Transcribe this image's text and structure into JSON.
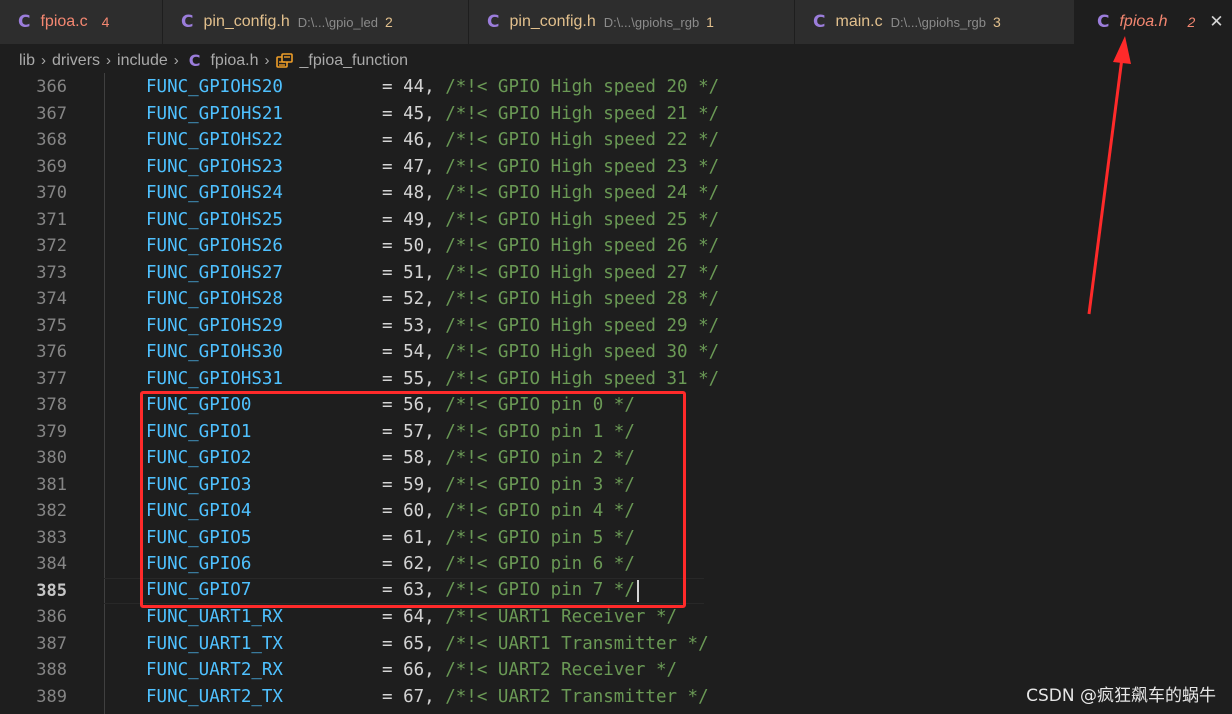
{
  "tabs": [
    {
      "lang": "C",
      "name": "fpioa.c",
      "path": "",
      "count": "4"
    },
    {
      "lang": "C",
      "name": "pin_config.h",
      "path": "D:\\...\\gpio_led",
      "count": "2"
    },
    {
      "lang": "C",
      "name": "pin_config.h",
      "path": "D:\\...\\gpiohs_rgb",
      "count": "1"
    },
    {
      "lang": "C",
      "name": "main.c",
      "path": "D:\\...\\gpiohs_rgb",
      "count": "3"
    },
    {
      "lang": "C",
      "name": "fpioa.h",
      "path": "",
      "count": "2",
      "close": "✕"
    }
  ],
  "breadcrumb": {
    "items": [
      "lib",
      "drivers",
      "include"
    ],
    "file_lang": "C",
    "file": "fpioa.h",
    "symbol": "_fpioa_function",
    "separator": "›"
  },
  "code_lines": [
    {
      "n": "366",
      "ident": "FUNC_GPIOHS20",
      "val": "44",
      "comment": "/*!< GPIO High speed 20 */"
    },
    {
      "n": "367",
      "ident": "FUNC_GPIOHS21",
      "val": "45",
      "comment": "/*!< GPIO High speed 21 */"
    },
    {
      "n": "368",
      "ident": "FUNC_GPIOHS22",
      "val": "46",
      "comment": "/*!< GPIO High speed 22 */"
    },
    {
      "n": "369",
      "ident": "FUNC_GPIOHS23",
      "val": "47",
      "comment": "/*!< GPIO High speed 23 */"
    },
    {
      "n": "370",
      "ident": "FUNC_GPIOHS24",
      "val": "48",
      "comment": "/*!< GPIO High speed 24 */"
    },
    {
      "n": "371",
      "ident": "FUNC_GPIOHS25",
      "val": "49",
      "comment": "/*!< GPIO High speed 25 */"
    },
    {
      "n": "372",
      "ident": "FUNC_GPIOHS26",
      "val": "50",
      "comment": "/*!< GPIO High speed 26 */"
    },
    {
      "n": "373",
      "ident": "FUNC_GPIOHS27",
      "val": "51",
      "comment": "/*!< GPIO High speed 27 */"
    },
    {
      "n": "374",
      "ident": "FUNC_GPIOHS28",
      "val": "52",
      "comment": "/*!< GPIO High speed 28 */"
    },
    {
      "n": "375",
      "ident": "FUNC_GPIOHS29",
      "val": "53",
      "comment": "/*!< GPIO High speed 29 */"
    },
    {
      "n": "376",
      "ident": "FUNC_GPIOHS30",
      "val": "54",
      "comment": "/*!< GPIO High speed 30 */"
    },
    {
      "n": "377",
      "ident": "FUNC_GPIOHS31",
      "val": "55",
      "comment": "/*!< GPIO High speed 31 */"
    },
    {
      "n": "378",
      "ident": "FUNC_GPIO0",
      "val": "56",
      "comment": "/*!< GPIO pin 0 */"
    },
    {
      "n": "379",
      "ident": "FUNC_GPIO1",
      "val": "57",
      "comment": "/*!< GPIO pin 1 */"
    },
    {
      "n": "380",
      "ident": "FUNC_GPIO2",
      "val": "58",
      "comment": "/*!< GPIO pin 2 */"
    },
    {
      "n": "381",
      "ident": "FUNC_GPIO3",
      "val": "59",
      "comment": "/*!< GPIO pin 3 */"
    },
    {
      "n": "382",
      "ident": "FUNC_GPIO4",
      "val": "60",
      "comment": "/*!< GPIO pin 4 */"
    },
    {
      "n": "383",
      "ident": "FUNC_GPIO5",
      "val": "61",
      "comment": "/*!< GPIO pin 5 */"
    },
    {
      "n": "384",
      "ident": "FUNC_GPIO6",
      "val": "62",
      "comment": "/*!< GPIO pin 6 */"
    },
    {
      "n": "385",
      "ident": "FUNC_GPIO7",
      "val": "63",
      "comment": "/*!< GPIO pin 7 */",
      "current": true
    },
    {
      "n": "386",
      "ident": "FUNC_UART1_RX",
      "val": "64",
      "comment": "/*!< UART1 Receiver */"
    },
    {
      "n": "387",
      "ident": "FUNC_UART1_TX",
      "val": "65",
      "comment": "/*!< UART1 Transmitter */"
    },
    {
      "n": "388",
      "ident": "FUNC_UART2_RX",
      "val": "66",
      "comment": "/*!< UART2 Receiver */"
    },
    {
      "n": "389",
      "ident": "FUNC_UART2_TX",
      "val": "67",
      "comment": "/*!< UART2 Transmitter */"
    }
  ],
  "watermark": "CSDN @疯狂飙车的蜗牛",
  "colors": {
    "annotation": "#ff2a2a",
    "identifier": "#4fc1ff",
    "comment": "#6a9955",
    "background": "#1e1e1e"
  }
}
